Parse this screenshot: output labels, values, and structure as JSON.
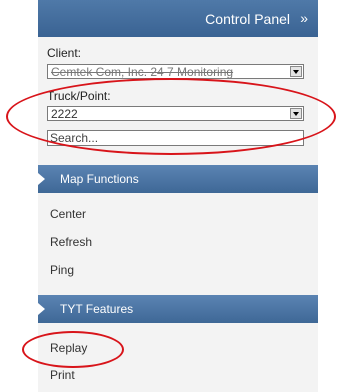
{
  "control_panel": {
    "title": "Control Panel",
    "collapse_icon": "double-chevron-right-icon",
    "collapse_glyph": "»"
  },
  "client": {
    "label": "Client:",
    "value": "Cemtek Com, Inc. 24 7 Monitoring"
  },
  "truck_point": {
    "label": "Truck/Point:",
    "value": "2222"
  },
  "search": {
    "text": "Search..."
  },
  "map_functions": {
    "title": "Map Functions",
    "items": [
      "Center",
      "Refresh",
      "Ping"
    ]
  },
  "tyt_features": {
    "title": "TYT Features",
    "items": [
      "Replay",
      "Print"
    ]
  },
  "colors": {
    "header_blue": "#3e6896",
    "annotation_red": "#d8141a"
  }
}
